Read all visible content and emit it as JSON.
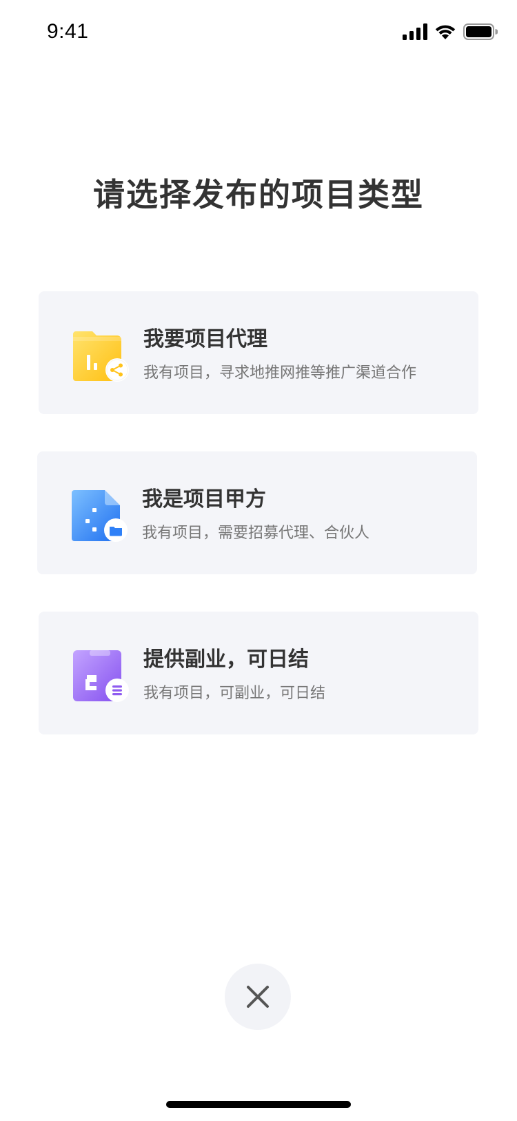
{
  "status_bar": {
    "time": "9:41",
    "icons": [
      "signal-icon",
      "wifi-icon",
      "battery-icon"
    ]
  },
  "title": "请选择发布的项目类型",
  "options": [
    {
      "title": "我要项目代理",
      "description": "我有项目，寻求地推网推等推广渠道合作",
      "icon": "folder-share-icon",
      "accent": "#ffc21a"
    },
    {
      "title": "我是项目甲方",
      "description": "我有项目，需要招募代理、合伙人",
      "icon": "document-folder-icon",
      "accent": "#2f80f7"
    },
    {
      "title": "提供副业，可日结",
      "description": "我有项目，可副业，可日结",
      "icon": "clipboard-list-icon",
      "accent": "#8f5cf0"
    }
  ],
  "close_button": {
    "icon": "close-icon"
  },
  "colors": {
    "card_background": "#f4f5f9",
    "title_text": "#333333",
    "description_text": "#777777",
    "close_background": "#f2f3f7"
  }
}
